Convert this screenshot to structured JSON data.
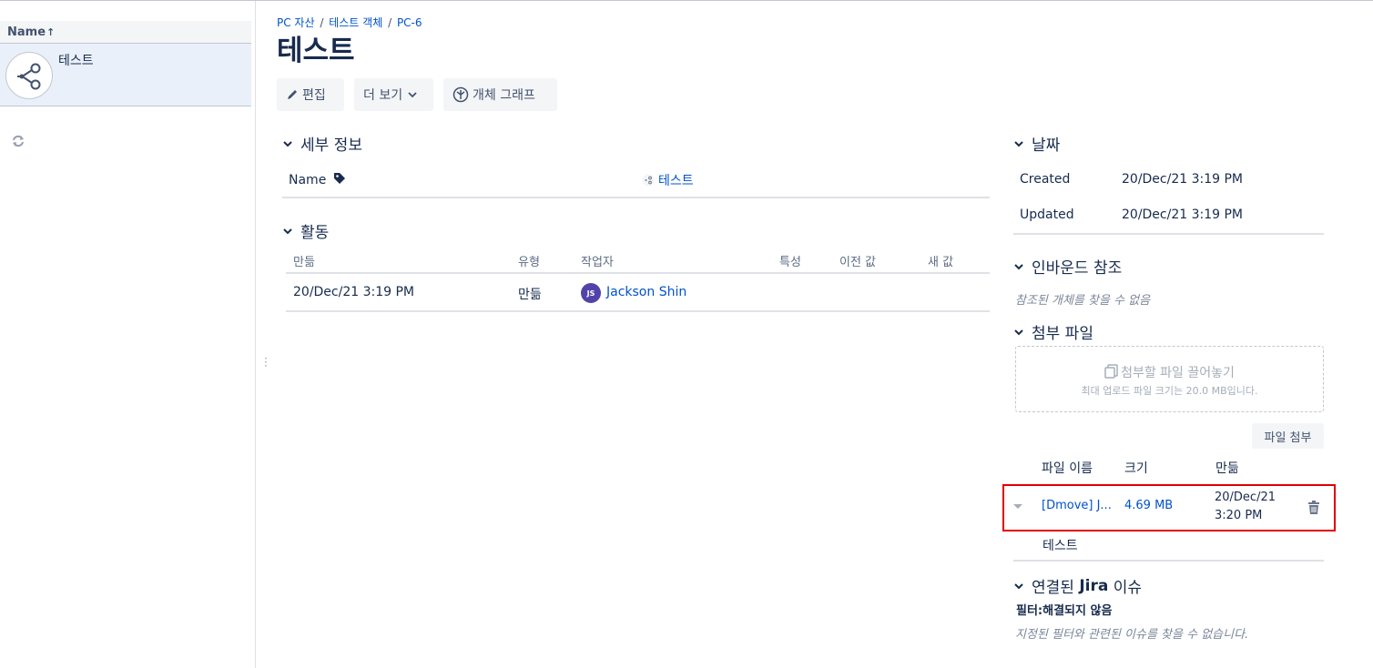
{
  "left_panel": {
    "column_header": "Name",
    "sort_arrow": "↑",
    "item_label": "테스트",
    "item_icon": "graph-node-icon",
    "refresh_icon": "refresh-icon"
  },
  "breadcrumb": {
    "items": [
      "PC 자산",
      "테스트 객체",
      "PC-6"
    ],
    "separator": "/"
  },
  "page_title": "테스트",
  "toolbar": {
    "edit_label": "편집",
    "more_label": "더 보기",
    "graph_label": "개체 그래프"
  },
  "details": {
    "title": "세부 정보",
    "name_label": "Name",
    "name_value": "테스트"
  },
  "activity": {
    "title": "활동",
    "headers": [
      "만듦",
      "유형",
      "작업자",
      "특성",
      "이전 값",
      "새 값"
    ],
    "rows": [
      {
        "date": "20/Dec/21 3:19 PM",
        "type": "만듦",
        "user_initials": "JS",
        "user": "Jackson Shin"
      }
    ]
  },
  "dates": {
    "title": "날짜",
    "created_label": "Created",
    "created_value": "20/Dec/21 3:19 PM",
    "updated_label": "Updated",
    "updated_value": "20/Dec/21 3:19 PM"
  },
  "inbound": {
    "title": "인바운드 참조",
    "empty": "참조된 개체를 찾을 수 없음"
  },
  "attachments": {
    "title": "첨부 파일",
    "drop_text": "첨부할 파일 끌어놓기",
    "drop_sub": "최대 업로드 파일 크기는 20.0 MB입니다.",
    "attach_button": "파일 첨부",
    "headers": [
      "파일 이름",
      "크기",
      "만듦"
    ],
    "rows": [
      {
        "name": "[Dmove] J...",
        "size": "4.69 MB",
        "created_date": "20/Dec/21",
        "created_time": "3:20 PM",
        "comment": "테스트"
      }
    ]
  },
  "jira": {
    "title_prefix": "연결된 ",
    "title_bold": "Jira",
    "title_suffix": " 이슈",
    "filter_label": "필터:해결되지 않음",
    "empty": "지정된 필터와 관련된 이슈를 찾을 수 없습니다."
  },
  "colors": {
    "link": "#0052cc",
    "text": "#172b4d",
    "highlight": "#e00000",
    "selected_row": "#e9f0fa",
    "avatar": "#5243aa"
  }
}
